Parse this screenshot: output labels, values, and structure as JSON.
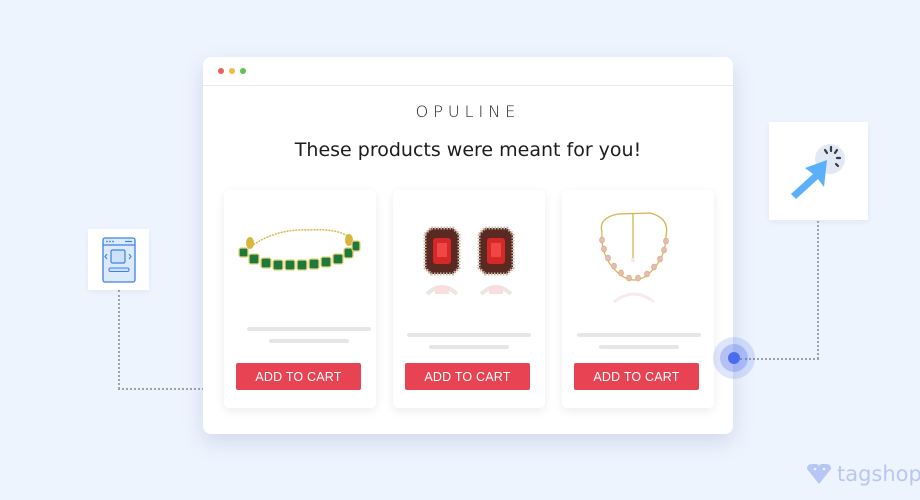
{
  "window": {
    "controls": [
      {
        "name": "close",
        "color": "#f0605a"
      },
      {
        "name": "minimize",
        "color": "#f6b83e"
      },
      {
        "name": "maximize",
        "color": "#5ac54d"
      }
    ]
  },
  "store": {
    "brand": "OPULINE",
    "headline": "These products were meant for you!"
  },
  "products": [
    {
      "name": "Emerald bracelet",
      "image": "emerald-bracelet-image",
      "button_label": "ADD TO CART"
    },
    {
      "name": "Ruby earrings",
      "image": "ruby-earrings-image",
      "button_label": "ADD TO CART"
    },
    {
      "name": "Pink stone necklace",
      "image": "pink-necklace-image",
      "button_label": "ADD TO CART"
    }
  ],
  "decorations": {
    "left_icon": "product-carousel-icon",
    "right_icon": "click-cursor-icon"
  },
  "footer": {
    "logo_text": "tagshop"
  },
  "colors": {
    "background": "#eef4fe",
    "button": "#e84352",
    "accent_blue": "#4a6cf0",
    "cursor_blue": "#5ab0fb",
    "logo": "#b7c7f5"
  }
}
